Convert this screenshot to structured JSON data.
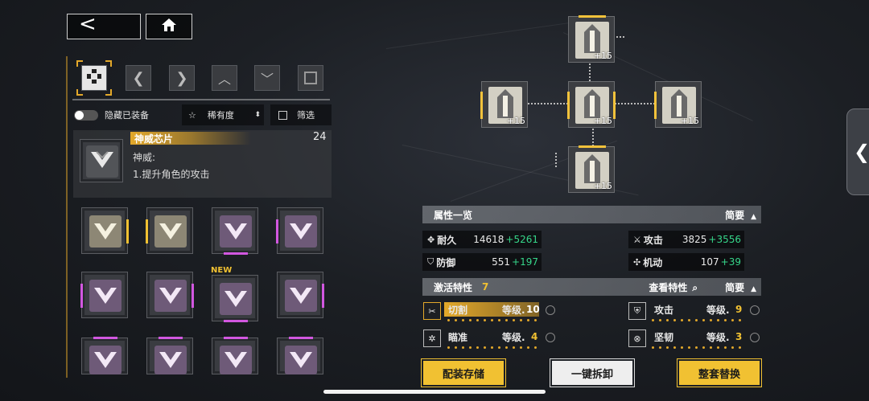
{
  "nav": {
    "back_glyph": "<",
    "home_icon": "home-icon"
  },
  "tabs": [
    "all-chips-icon",
    "first-icon",
    "last-icon",
    "up-icon",
    "down-icon",
    "frame-icon"
  ],
  "filter": {
    "hide_equipped": "隐藏已装备",
    "rarity": "稀有度",
    "filter_label": "筛选"
  },
  "chip_detail": {
    "name": "神威芯片",
    "count": "24",
    "subtitle": "神威:",
    "effect": "1.提升角色的攻击"
  },
  "new_badge": "NEW",
  "tree_levels": [
    "+15",
    "+15",
    "+15",
    "+15",
    "+15"
  ],
  "attributes": {
    "title": "属性一览",
    "summary": "简要",
    "durability": {
      "label": "耐久",
      "value": "14618",
      "bonus": "+5261"
    },
    "attack": {
      "label": "攻击",
      "value": "3825",
      "bonus": "+3556"
    },
    "defense": {
      "label": "防御",
      "value": "551",
      "bonus": "+197"
    },
    "mobility": {
      "label": "机动",
      "value": "107",
      "bonus": "+39"
    }
  },
  "traits": {
    "title": "激活特性",
    "count": "7",
    "view_label": "查看特性",
    "summary": "简要",
    "items": [
      {
        "name": "切割",
        "level_label": "等级.",
        "level": "10"
      },
      {
        "name": "攻击",
        "level_label": "等级.",
        "level": "9"
      },
      {
        "name": "瞄准",
        "level_label": "等级.",
        "level": "4"
      },
      {
        "name": "坚韧",
        "level_label": "等级.",
        "level": "3"
      }
    ]
  },
  "actions": {
    "save": "配装存储",
    "unequip_all": "一键拆卸",
    "replace_set": "整套替换"
  },
  "colors": {
    "gold": "#f1c132",
    "purple": "#d257e0",
    "green": "#36d68a"
  }
}
